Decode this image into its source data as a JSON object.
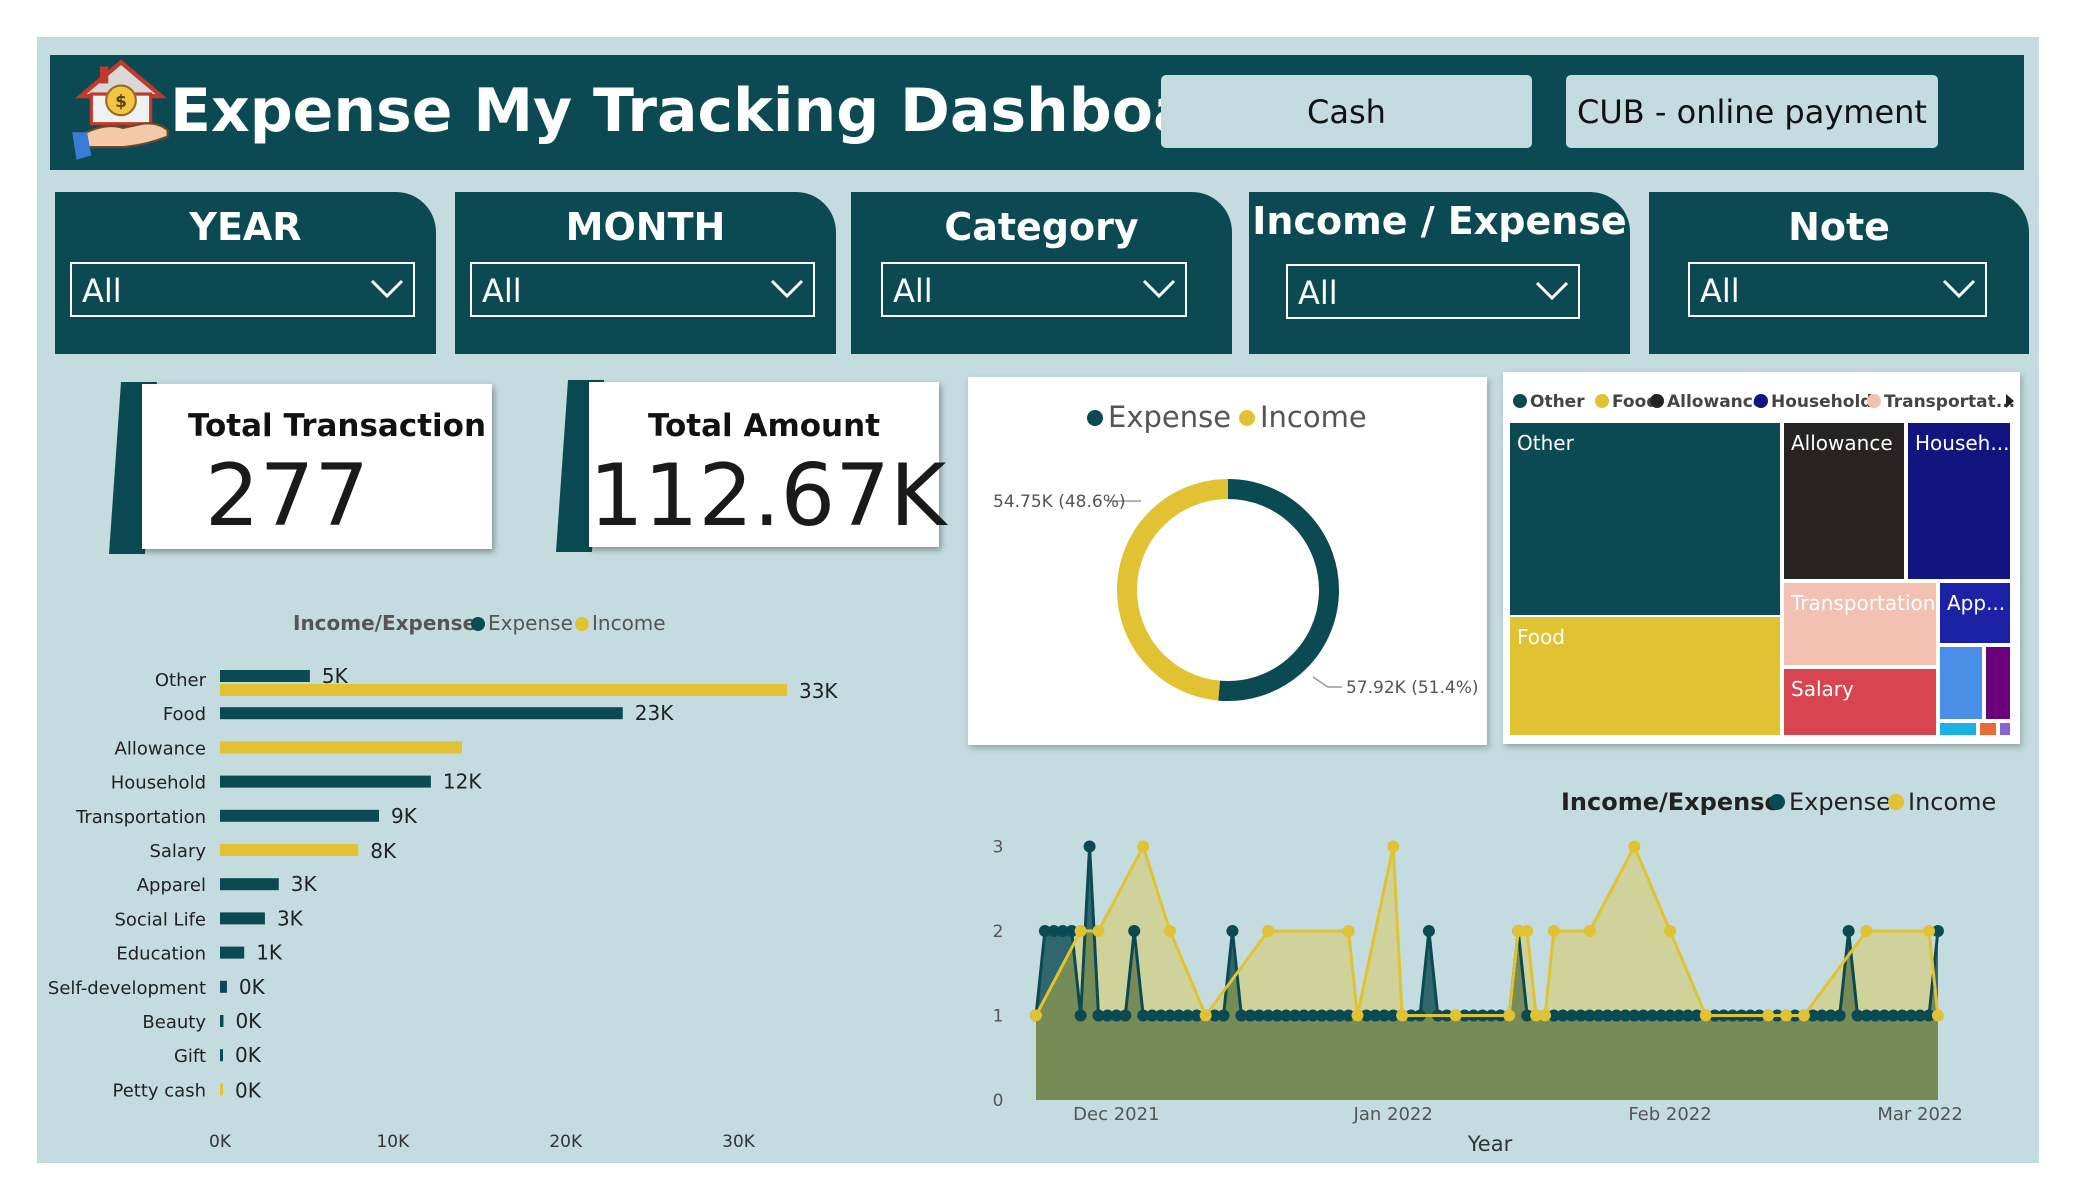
{
  "header": {
    "title": "Expense My Tracking Dashboard",
    "buttons": [
      "Cash",
      "CUB - online payment"
    ]
  },
  "slicers": [
    {
      "title": "YEAR",
      "value": "All"
    },
    {
      "title": "MONTH",
      "value": "All"
    },
    {
      "title": "Category",
      "value": "All"
    },
    {
      "title": "Income / Expense",
      "value": "All"
    },
    {
      "title": "Note",
      "value": "All"
    }
  ],
  "kpis": {
    "total_transaction": {
      "label": "Total Transaction",
      "value": "277"
    },
    "total_amount": {
      "label": "Total Amount",
      "value": "112.67K"
    }
  },
  "colors": {
    "expense": "#0b4a52",
    "income": "#e0c232",
    "allowance": "#252423",
    "household": "#12157f",
    "transportation": "#f2c1b2",
    "salary": "#d64550",
    "apparel": "#1c22a6",
    "panel_bg": "#c4dcdf"
  },
  "chart_data": [
    {
      "type": "bar",
      "orientation": "horizontal",
      "legend_title": "Income/Expense",
      "categories": [
        "Other",
        "Food",
        "Allowance",
        "Household",
        "Transportation",
        "Salary",
        "Apparel",
        "Social Life",
        "Education",
        "Self-development",
        "Beauty",
        "Gift",
        "Petty cash"
      ],
      "series": [
        {
          "name": "Expense",
          "values": [
            5200,
            23300,
            null,
            12200,
            9200,
            null,
            3400,
            2600,
            1400,
            400,
            200,
            100,
            null
          ],
          "labels": [
            "5K",
            "23K",
            "",
            "12K",
            "9K",
            "",
            "3K",
            "3K",
            "1K",
            "0K",
            "0K",
            "0K",
            ""
          ]
        },
        {
          "name": "Income",
          "values": [
            32800,
            null,
            14000,
            null,
            null,
            8000,
            null,
            null,
            null,
            null,
            null,
            null,
            100
          ],
          "labels": [
            "33K",
            "",
            "",
            "",
            "",
            "8K",
            "",
            "",
            "",
            "",
            "",
            "",
            "0K"
          ]
        }
      ],
      "xticks": [
        "0K",
        "10K",
        "20K",
        "30K"
      ],
      "xlim": [
        0,
        35000
      ]
    },
    {
      "type": "pie",
      "variant": "donut",
      "legend": [
        "Expense",
        "Income"
      ],
      "slices": [
        {
          "name": "Expense",
          "value": 57920,
          "label": "57.92K (51.4%)"
        },
        {
          "name": "Income",
          "value": 54750,
          "label": "54.75K (48.6%)"
        }
      ]
    },
    {
      "type": "treemap",
      "legend": [
        "Other",
        "Food",
        "Allowance",
        "Household",
        "Transportat..."
      ],
      "tiles": [
        {
          "name": "Other",
          "label": "Other",
          "value": 38000
        },
        {
          "name": "Food",
          "label": "Food",
          "value": 23300
        },
        {
          "name": "Allowance",
          "label": "Allowance",
          "value": 14000
        },
        {
          "name": "Household",
          "label": "Househ...",
          "value": 12200
        },
        {
          "name": "Transportation",
          "label": "Transportation",
          "value": 9200
        },
        {
          "name": "Salary",
          "label": "Salary",
          "value": 8000
        },
        {
          "name": "Apparel",
          "label": "App...",
          "value": 3400
        },
        {
          "name": "Social Life",
          "label": "",
          "value": 2600
        },
        {
          "name": "Education",
          "label": "",
          "value": 1400
        },
        {
          "name": "Self-development",
          "label": "",
          "value": 400
        },
        {
          "name": "Beauty",
          "label": "",
          "value": 200
        },
        {
          "name": "Gift",
          "label": "",
          "value": 100
        }
      ]
    },
    {
      "type": "area",
      "legend_title": "Income/Expense",
      "xlabel": "Year",
      "xticks": [
        "Dec 2021",
        "Jan 2022",
        "Feb 2022",
        "Mar 2022"
      ],
      "ylim": [
        0,
        3
      ],
      "yticks": [
        "0",
        "1",
        "2",
        "3"
      ],
      "x_start": "2021-11-22",
      "series": [
        {
          "name": "Expense",
          "points": [
            [
              "2021-11-22",
              1
            ],
            [
              "2021-11-23",
              2
            ],
            [
              "2021-11-24",
              2
            ],
            [
              "2021-11-25",
              2
            ],
            [
              "2021-11-26",
              2
            ],
            [
              "2021-11-27",
              1
            ],
            [
              "2021-11-28",
              3
            ],
            [
              "2021-11-29",
              1
            ],
            [
              "2021-11-30",
              1
            ],
            [
              "2021-12-01",
              1
            ],
            [
              "2021-12-02",
              1
            ],
            [
              "2021-12-03",
              2
            ],
            [
              "2021-12-04",
              1
            ],
            [
              "2021-12-05",
              1
            ],
            [
              "2021-12-06",
              1
            ],
            [
              "2021-12-07",
              1
            ],
            [
              "2021-12-08",
              1
            ],
            [
              "2021-12-09",
              1
            ],
            [
              "2021-12-10",
              1
            ],
            [
              "2021-12-11",
              1
            ],
            [
              "2021-12-12",
              1
            ],
            [
              "2021-12-13",
              1
            ],
            [
              "2021-12-14",
              2
            ],
            [
              "2021-12-15",
              1
            ],
            [
              "2021-12-16",
              1
            ],
            [
              "2021-12-17",
              1
            ],
            [
              "2021-12-18",
              1
            ],
            [
              "2021-12-19",
              1
            ],
            [
              "2021-12-20",
              1
            ],
            [
              "2021-12-21",
              1
            ],
            [
              "2021-12-22",
              1
            ],
            [
              "2021-12-23",
              1
            ],
            [
              "2021-12-24",
              1
            ],
            [
              "2021-12-25",
              1
            ],
            [
              "2021-12-26",
              1
            ],
            [
              "2021-12-27",
              1
            ],
            [
              "2021-12-28",
              1
            ],
            [
              "2021-12-29",
              1
            ],
            [
              "2021-12-30",
              1
            ],
            [
              "2021-12-31",
              1
            ],
            [
              "2022-01-01",
              1
            ],
            [
              "2022-01-02",
              1
            ],
            [
              "2022-01-03",
              1
            ],
            [
              "2022-01-04",
              1
            ],
            [
              "2022-01-05",
              2
            ],
            [
              "2022-01-06",
              1
            ],
            [
              "2022-01-07",
              1
            ],
            [
              "2022-01-08",
              1
            ],
            [
              "2022-01-09",
              1
            ],
            [
              "2022-01-10",
              1
            ],
            [
              "2022-01-11",
              1
            ],
            [
              "2022-01-12",
              1
            ],
            [
              "2022-01-13",
              1
            ],
            [
              "2022-01-14",
              1
            ],
            [
              "2022-01-15",
              2
            ],
            [
              "2022-01-16",
              1
            ],
            [
              "2022-01-17",
              1
            ],
            [
              "2022-01-18",
              1
            ],
            [
              "2022-01-19",
              1
            ],
            [
              "2022-01-20",
              1
            ],
            [
              "2022-01-21",
              1
            ],
            [
              "2022-01-22",
              1
            ],
            [
              "2022-01-23",
              1
            ],
            [
              "2022-01-24",
              1
            ],
            [
              "2022-01-25",
              1
            ],
            [
              "2022-01-26",
              1
            ],
            [
              "2022-01-27",
              1
            ],
            [
              "2022-01-28",
              1
            ],
            [
              "2022-01-29",
              1
            ],
            [
              "2022-01-30",
              1
            ],
            [
              "2022-01-31",
              1
            ],
            [
              "2022-02-01",
              1
            ],
            [
              "2022-02-02",
              1
            ],
            [
              "2022-02-03",
              1
            ],
            [
              "2022-02-04",
              1
            ],
            [
              "2022-02-05",
              1
            ],
            [
              "2022-02-06",
              1
            ],
            [
              "2022-02-07",
              1
            ],
            [
              "2022-02-08",
              1
            ],
            [
              "2022-02-09",
              1
            ],
            [
              "2022-02-10",
              1
            ],
            [
              "2022-02-11",
              1
            ],
            [
              "2022-02-12",
              1
            ],
            [
              "2022-02-13",
              1
            ],
            [
              "2022-02-14",
              1
            ],
            [
              "2022-02-15",
              1
            ],
            [
              "2022-02-16",
              1
            ],
            [
              "2022-02-17",
              1
            ],
            [
              "2022-02-18",
              1
            ],
            [
              "2022-02-19",
              1
            ],
            [
              "2022-02-20",
              1
            ],
            [
              "2022-02-21",
              2
            ],
            [
              "2022-02-22",
              1
            ],
            [
              "2022-02-23",
              1
            ],
            [
              "2022-02-24",
              1
            ],
            [
              "2022-02-25",
              1
            ],
            [
              "2022-02-26",
              1
            ],
            [
              "2022-02-27",
              1
            ],
            [
              "2022-02-28",
              1
            ],
            [
              "2022-03-01",
              1
            ],
            [
              "2022-03-02",
              1
            ],
            [
              "2022-03-03",
              2
            ]
          ]
        },
        {
          "name": "Income",
          "points": [
            [
              "2021-11-22",
              1
            ],
            [
              "2021-11-27",
              2
            ],
            [
              "2021-11-29",
              2
            ],
            [
              "2021-12-04",
              3
            ],
            [
              "2021-12-07",
              2
            ],
            [
              "2021-12-11",
              1
            ],
            [
              "2021-12-18",
              2
            ],
            [
              "2021-12-27",
              2
            ],
            [
              "2021-12-28",
              1
            ],
            [
              "2022-01-01",
              3
            ],
            [
              "2022-01-02",
              1
            ],
            [
              "2022-01-08",
              1
            ],
            [
              "2022-01-14",
              1
            ],
            [
              "2022-01-15",
              2
            ],
            [
              "2022-01-16",
              2
            ],
            [
              "2022-01-17",
              1
            ],
            [
              "2022-01-18",
              1
            ],
            [
              "2022-01-19",
              2
            ],
            [
              "2022-01-23",
              2
            ],
            [
              "2022-01-28",
              3
            ],
            [
              "2022-02-01",
              2
            ],
            [
              "2022-02-05",
              1
            ],
            [
              "2022-02-12",
              1
            ],
            [
              "2022-02-14",
              1
            ],
            [
              "2022-02-16",
              1
            ],
            [
              "2022-02-23",
              2
            ],
            [
              "2022-03-02",
              2
            ],
            [
              "2022-03-03",
              1
            ]
          ]
        }
      ]
    }
  ]
}
